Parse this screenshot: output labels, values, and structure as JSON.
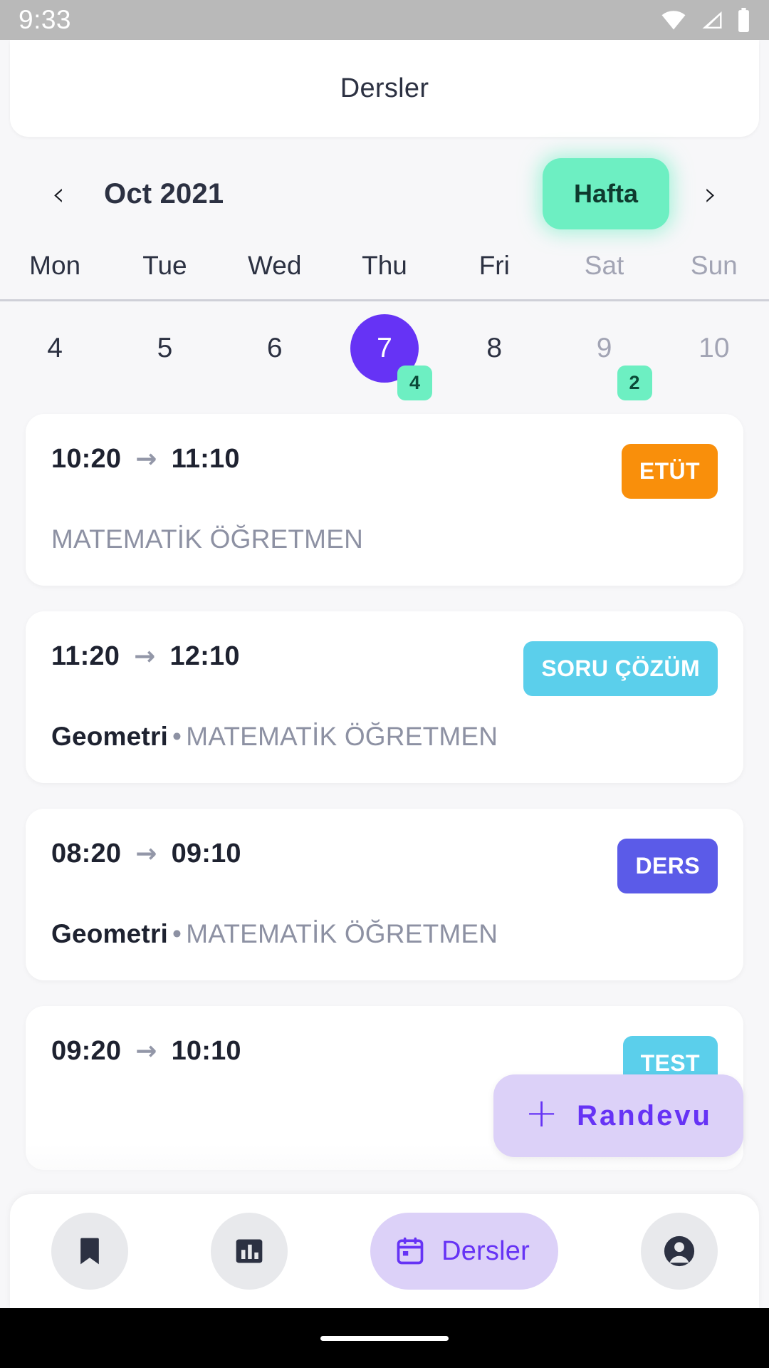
{
  "status_bar": {
    "time": "9:33",
    "icons": [
      "wifi-icon",
      "signal-icon",
      "battery-icon"
    ]
  },
  "app_bar": {
    "title": "Dersler"
  },
  "month_nav": {
    "prev_icon": "chevron-left-icon",
    "next_icon": "chevron-right-icon",
    "month_label": "Oct 2021",
    "view_toggle_label": "Hafta",
    "view_toggle_color": "#6DEFC2"
  },
  "calendar": {
    "weekdays": [
      {
        "label": "Mon",
        "weekend": false
      },
      {
        "label": "Tue",
        "weekend": false
      },
      {
        "label": "Wed",
        "weekend": false
      },
      {
        "label": "Thu",
        "weekend": false
      },
      {
        "label": "Fri",
        "weekend": false
      },
      {
        "label": "Sat",
        "weekend": true
      },
      {
        "label": "Sun",
        "weekend": true
      }
    ],
    "days": [
      {
        "num": "4",
        "selected": false,
        "weekend": false,
        "badge": ""
      },
      {
        "num": "5",
        "selected": false,
        "weekend": false,
        "badge": ""
      },
      {
        "num": "6",
        "selected": false,
        "weekend": false,
        "badge": ""
      },
      {
        "num": "7",
        "selected": true,
        "weekend": false,
        "badge": "4"
      },
      {
        "num": "8",
        "selected": false,
        "weekend": false,
        "badge": ""
      },
      {
        "num": "9",
        "selected": false,
        "weekend": true,
        "badge": "2"
      },
      {
        "num": "10",
        "selected": false,
        "weekend": true,
        "badge": ""
      }
    ],
    "selected_color": "#6633F5",
    "badge_color": "#6DEFC2"
  },
  "events": [
    {
      "start": "10:20",
      "arrow": "→",
      "end": "11:10",
      "tag": "ETÜT",
      "tag_color": "#F98F0B",
      "subject": "",
      "separator": "",
      "teacher": "MATEMATİK ÖĞRETMEN"
    },
    {
      "start": "11:20",
      "arrow": "→",
      "end": "12:10",
      "tag": "SORU ÇÖZÜM",
      "tag_color": "#5BCFEB",
      "subject": "Geometri",
      "separator": "•",
      "teacher": "MATEMATİK ÖĞRETMEN"
    },
    {
      "start": "08:20",
      "arrow": "→",
      "end": "09:10",
      "tag": "DERS",
      "tag_color": "#5B5BE8",
      "subject": "Geometri",
      "separator": "•",
      "teacher": "MATEMATİK ÖĞRETMEN"
    },
    {
      "start": "09:20",
      "arrow": "→",
      "end": "10:10",
      "tag": "TEST",
      "tag_color": "#5BCFEB",
      "subject": "",
      "separator": "",
      "teacher": ""
    }
  ],
  "fab": {
    "plus_icon": "plus-icon",
    "label": "Randevu",
    "background": "#DCD1F8",
    "text_color": "#6633F5"
  },
  "bottom_nav": [
    {
      "icon": "bookmark-icon",
      "label": "",
      "active": false
    },
    {
      "icon": "bar-chart-icon",
      "label": "",
      "active": false
    },
    {
      "icon": "calendar-icon",
      "label": "Dersler",
      "active": true
    },
    {
      "icon": "account-icon",
      "label": "",
      "active": false
    }
  ]
}
